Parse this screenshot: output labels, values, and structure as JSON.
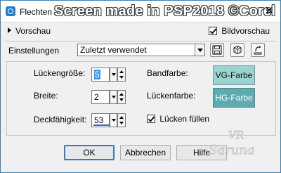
{
  "window": {
    "title_small": "Flechten",
    "title_big": "Screen made in PSP2018 ©Corel",
    "close_label": "✕"
  },
  "preview": {
    "label": "Vorschau",
    "image_preview_label": "Bildvorschau",
    "image_preview_checked": true
  },
  "settings": {
    "label": "Einstellungen",
    "value": "Zuletzt verwendet"
  },
  "fields": {
    "gap_size_label": "Lückengröße:",
    "gap_size_value": "5",
    "width_label": "Breite:",
    "width_value": "2",
    "opacity_label": "Deckfähigkeit:",
    "opacity_value": "53",
    "opacity_fraction": 0.53
  },
  "colors": {
    "band_label": "Bandfarbe:",
    "band_swatch": "VG-Farbe",
    "band_color": "#9ad4d2",
    "gap_label": "Lückenfarbe:",
    "gap_swatch": "HG-Farbe",
    "gap_color": "#5cabb0",
    "fill_gaps_label": "Lücken füllen",
    "fill_gaps_checked": true
  },
  "buttons": {
    "ok": "OK",
    "cancel": "Abbrechen",
    "help": "Hilfe"
  },
  "watermark": {
    "line1": "VR",
    "line2": "Saruna"
  }
}
